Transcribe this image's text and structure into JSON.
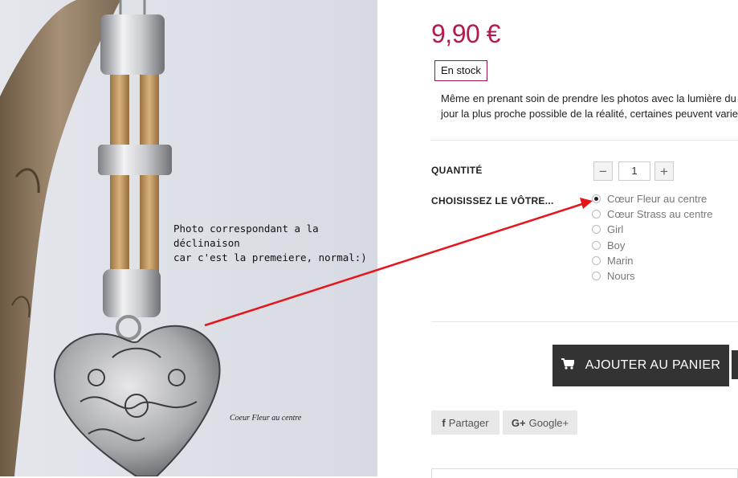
{
  "photo": {
    "note": "Photo correspondant a la déclinaison\ncar c'est la premeiere, normal:)",
    "label": "Coeur Fleur au centre"
  },
  "product": {
    "price": "9,90 €",
    "stock": "En stock",
    "note": "Même en prenant soin de prendre les photos avec la lumière du jour la plus proche possible de la réalité, certaines peuvent varier.",
    "accent_color": "#b11c4c"
  },
  "quantity": {
    "label": "QUANTITÉ",
    "value": "1",
    "minus": "−",
    "plus": "+"
  },
  "variant": {
    "label": "CHOISISSEZ LE VÔTRE...",
    "options": [
      "Cœur Fleur au centre",
      "Cœur Strass au centre",
      "Girl",
      "Boy",
      "Marin",
      "Nours"
    ],
    "selected": "Cœur Fleur au centre"
  },
  "cart": {
    "label": "AJOUTER AU PANIER",
    "icon": "cart-icon"
  },
  "share": {
    "facebook": "Partager",
    "facebook_icon": "f",
    "google": "Google+",
    "google_icon": "G+"
  }
}
